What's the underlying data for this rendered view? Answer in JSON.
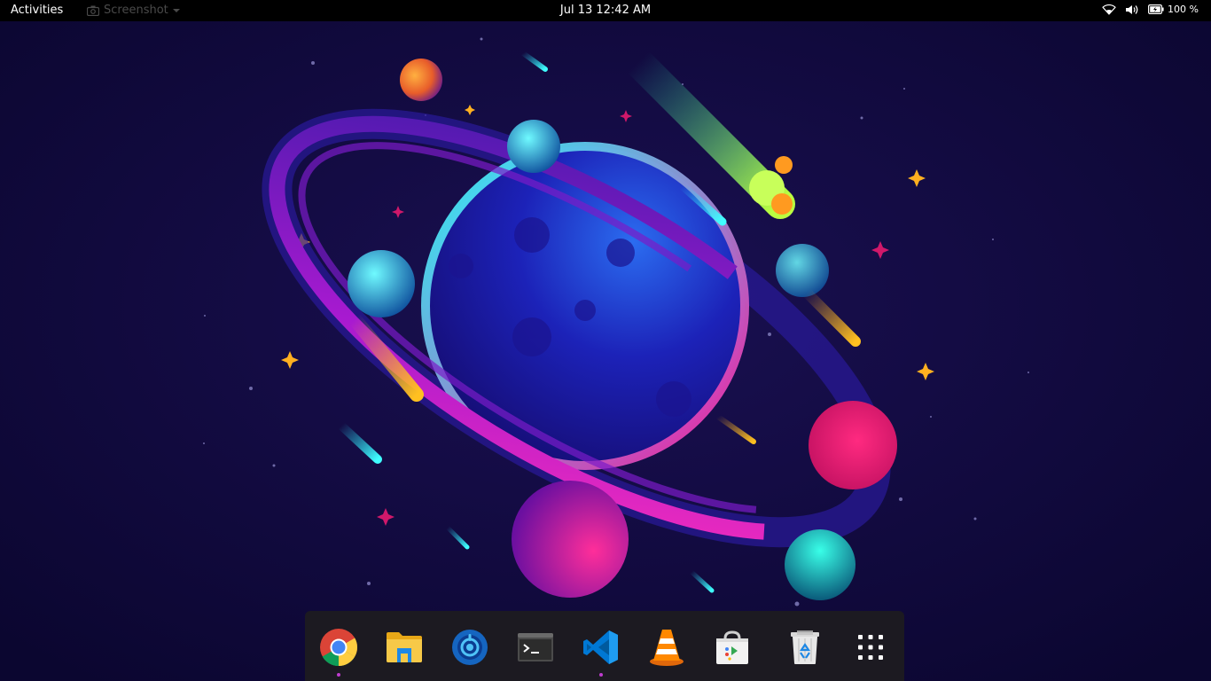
{
  "topbar": {
    "activities": "Activities",
    "app_menu": "Screenshot",
    "datetime": "Jul 13  12:42 AM",
    "battery_percent": "100 %"
  },
  "dock": {
    "items": [
      {
        "name": "Google Chrome",
        "icon": "chrome-icon",
        "running": true
      },
      {
        "name": "Files",
        "icon": "folder-icon",
        "running": false
      },
      {
        "name": "Budgie Control",
        "icon": "blue-circle-app-icon",
        "running": false
      },
      {
        "name": "Terminal",
        "icon": "terminal-icon",
        "running": false
      },
      {
        "name": "Visual Studio Code",
        "icon": "vscode-icon",
        "running": true
      },
      {
        "name": "VLC media player",
        "icon": "vlc-cone-icon",
        "running": false
      },
      {
        "name": "Software",
        "icon": "software-store-icon",
        "running": false
      },
      {
        "name": "Trash",
        "icon": "trash-icon",
        "running": false
      },
      {
        "name": "Show Applications",
        "icon": "app-grid-icon",
        "running": false
      }
    ]
  },
  "colors": {
    "background": "#0d0733",
    "topbar": "#000000",
    "dock": "#1c1a21",
    "running_indicator": "#c03cd0"
  }
}
